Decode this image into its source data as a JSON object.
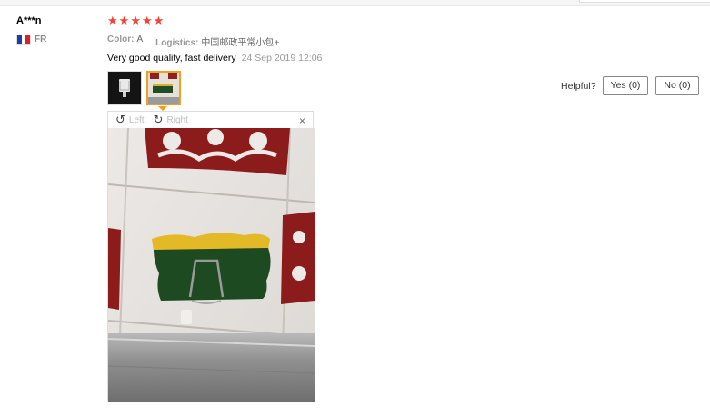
{
  "review": {
    "reviewer": "A***n",
    "country_code": "FR",
    "flag_colors": [
      "#1f3fa0",
      "#ffffff",
      "#d8212a"
    ],
    "rating": 5,
    "rating_color": "#f44336",
    "color_label": "Color:",
    "color_value": "A",
    "logistics_label": "Logistics:",
    "logistics_value": "中国邮政平常小包+",
    "text": "Very good quality, fast delivery",
    "date": "24 Sep 2019 12:06"
  },
  "helpful": {
    "label": "Helpful?",
    "yes": "Yes (0)",
    "no": "No (0)"
  },
  "viewer": {
    "left_label": "Left",
    "right_label": "Right",
    "close": "×"
  }
}
